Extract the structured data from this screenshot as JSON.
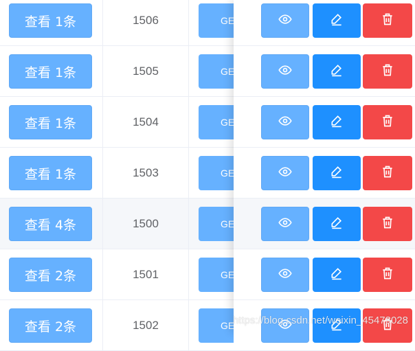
{
  "rows": [
    {
      "view_label": "查看 1条",
      "id": "1506",
      "get_label": "GE",
      "highlighted": false
    },
    {
      "view_label": "查看 1条",
      "id": "1505",
      "get_label": "GE",
      "highlighted": false
    },
    {
      "view_label": "查看 1条",
      "id": "1504",
      "get_label": "GE",
      "highlighted": false
    },
    {
      "view_label": "查看 1条",
      "id": "1503",
      "get_label": "GE",
      "highlighted": false
    },
    {
      "view_label": "查看 4条",
      "id": "1500",
      "get_label": "GE",
      "highlighted": true
    },
    {
      "view_label": "查看 2条",
      "id": "1501",
      "get_label": "GE",
      "highlighted": false
    },
    {
      "view_label": "查看 2条",
      "id": "1502",
      "get_label": "GE",
      "highlighted": false
    }
  ],
  "actions": {
    "view_icon": "eye-icon",
    "edit_icon": "pencil-icon",
    "delete_icon": "trash-icon"
  },
  "colors": {
    "primary_light": "#66b1ff",
    "primary": "#1e90ff",
    "danger": "#f34848",
    "text": "#606266",
    "row_highlight": "#f5f7fa"
  },
  "watermark": "https://blog.csdn.net/weixin_45473028"
}
